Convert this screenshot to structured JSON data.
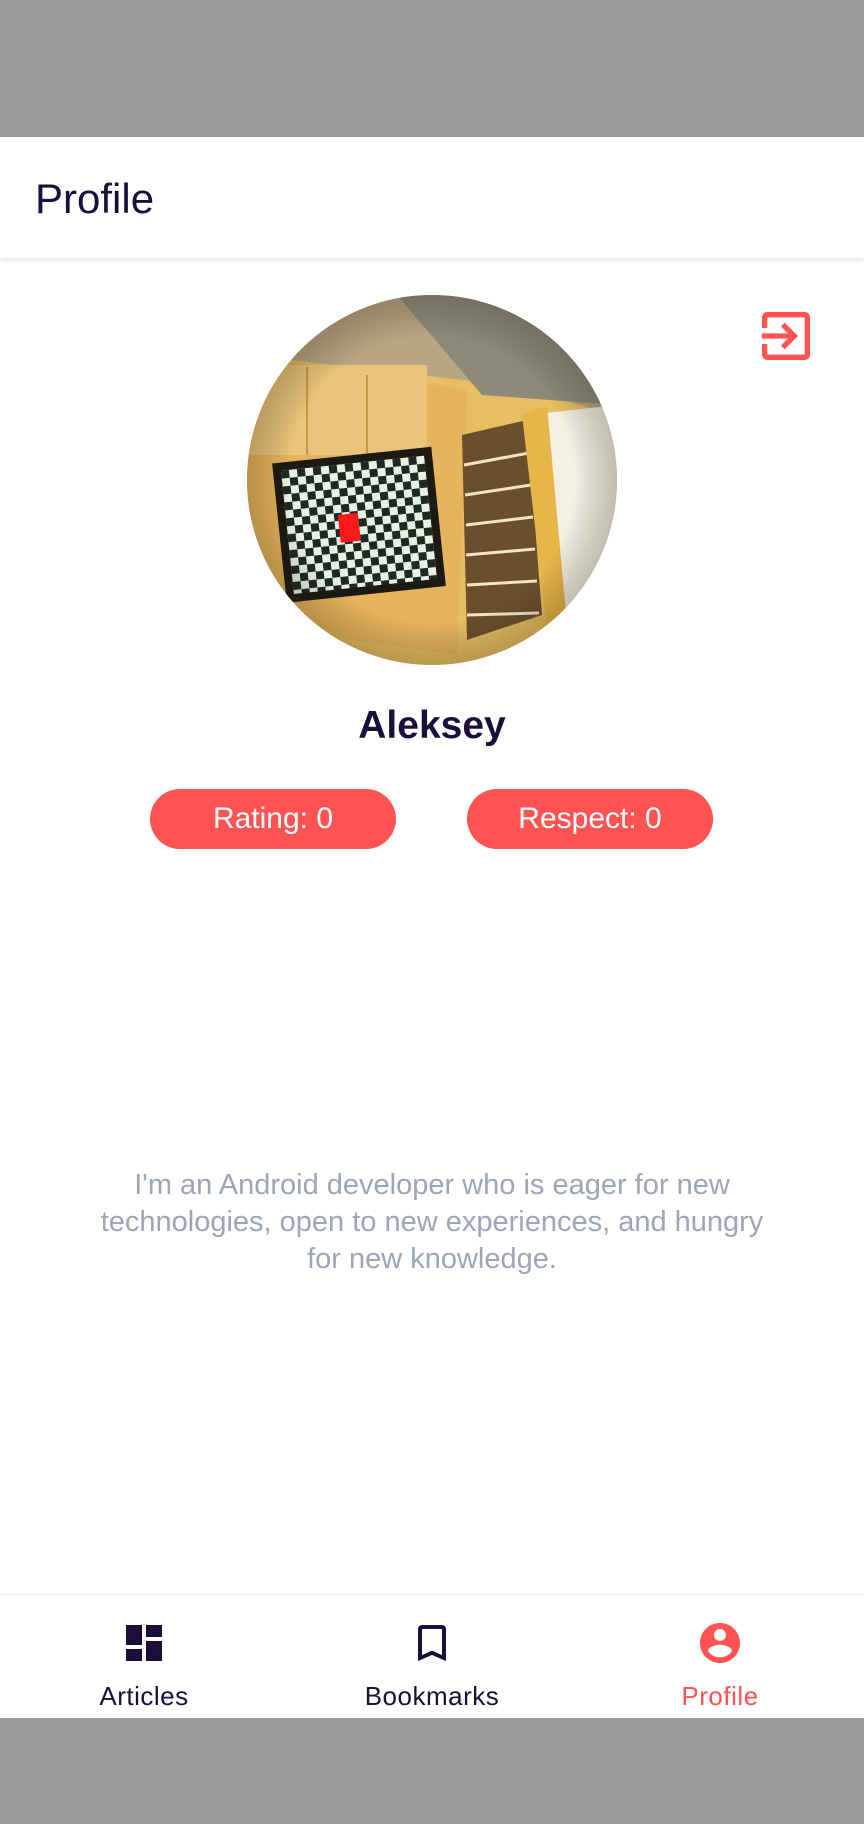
{
  "toolbar": {
    "title": "Profile"
  },
  "logout": {
    "icon": "logout-icon",
    "color": "#ff5252"
  },
  "profile": {
    "avatar": "avatar-photo",
    "name": "Aleksey",
    "rating_label": "Rating: 0",
    "respect_label": "Respect: 0",
    "about": "I'm an Android developer who is eager for new technologies, open to new experiences, and hungry for new knowledge."
  },
  "bottom_nav": {
    "items": [
      {
        "label": "Articles",
        "icon": "dashboard-icon",
        "active": false
      },
      {
        "label": "Bookmarks",
        "icon": "bookmark-icon",
        "active": false
      },
      {
        "label": "Profile",
        "icon": "account-circle-icon",
        "active": true
      }
    ]
  },
  "colors": {
    "accent": "#ff5252",
    "primary_text": "#1a0f3c",
    "secondary_text": "#9ea5b8"
  }
}
